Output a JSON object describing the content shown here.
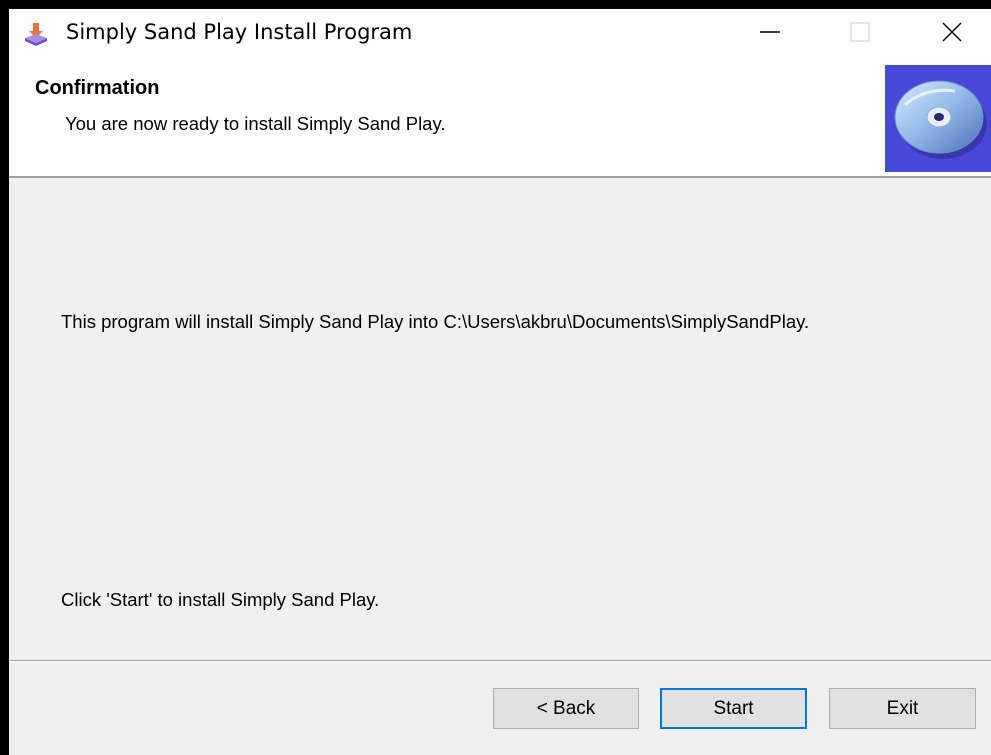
{
  "window": {
    "title": "Simply Sand Play Install Program",
    "app_icon": "installer-icon"
  },
  "titlebar_controls": {
    "minimize_icon": "minimize-icon",
    "maximize_icon": "maximize-icon",
    "close_icon": "close-icon"
  },
  "header": {
    "title": "Confirmation",
    "subtitle": "You are now ready to install Simply Sand Play.",
    "image": "cd-disc-icon"
  },
  "body": {
    "install_path_message": "This program will install Simply Sand Play into C:\\Users\\akbru\\Documents\\SimplySandPlay.",
    "start_instruction": "Click 'Start' to install Simply Sand Play."
  },
  "buttons": {
    "back_label": "< Back",
    "start_label": "Start",
    "exit_label": "Exit"
  },
  "colors": {
    "dialog_background": "#f0f0f0",
    "header_background": "#ffffff",
    "cd_background": "#4848d8",
    "focus_border": "#0078d7"
  }
}
